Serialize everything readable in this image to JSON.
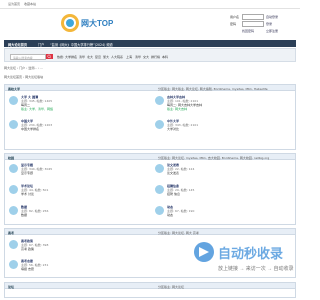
{
  "topbar": {
    "set_home": "设为首页",
    "bookmark": "收藏本站"
  },
  "header": {
    "logo_text": "网大TOP",
    "login": {
      "user_label": "用户名",
      "pass_label": "密码",
      "autologin": "自动登录",
      "find_pass": "找回密码",
      "login_btn": "登录",
      "register_btn": "立即注册"
    }
  },
  "nav": {
    "items": [
      "网大论坛首页",
      "门户",
      "“监测《网大》中国大学排行榜”(2024) 频道"
    ]
  },
  "subnav": {
    "search_placeholder": "请输入搜索内容",
    "hot_label": "热搜:",
    "hot": [
      "大学排名",
      "清华",
      "北大",
      "复旦",
      "浙大",
      "人大院系",
      "上海",
      "清华",
      "交大",
      "排行榜",
      "本科"
    ]
  },
  "breadcrumb": {
    "items": [
      "网大论坛",
      "›",
      "门户",
      "›",
      "监测...",
      "›",
      "..."
    ]
  },
  "breadcrumb2": {
    "text": "网大论坛首页 › 网大论坛版块"
  },
  "sections": [
    {
      "title": "高校大学",
      "moderator": "分区版主: 网大版主, 网大论坛, 网大编辑, BnnShema, mysites, MK1, HabsoMe",
      "rss": "RSS",
      "forums": [
        {
          "name": "大学 大 圆满",
          "stat": "主题: 345, 帖数: 1405",
          "last": "每周二",
          "extra": "版主: 大学、清华、网络"
        },
        {
          "name": "吉林大学吉林",
          "stat": "主题: 101, 帖数: 2101",
          "last": "每周二: 网大吉林大学吉林",
          "extra": "版主: 网大吉林"
        },
        {
          "name": "中国大学",
          "stat": "主题: 234, 帖数: 1203",
          "last": "中国大学排名",
          "extra": ""
        },
        {
          "name": "中外大学",
          "stat": "主题: 343, 帖数: 2101",
          "last": "大学对比",
          "extra": ""
        }
      ]
    },
    {
      "title": "校园",
      "moderator": "分区版主: 网大论坛, mysites, MK1, 吉大校园, BnnShema, 网大校园, netbig.org",
      "rss": "RSS",
      "forums": [
        {
          "name": "显示专题",
          "stat": "主题: 344, 帖数: 3045",
          "last": "显示专题",
          "extra": ""
        },
        {
          "name": "论文发表",
          "stat": "主题: 22, 帖数: 124",
          "last": "论文发表",
          "extra": ""
        },
        {
          "name": "学术论坛",
          "stat": "主题: 44, 帖数: 501",
          "last": "学术 讨论",
          "extra": ""
        },
        {
          "name": "招聘信息",
          "stat": "主题: 29, 帖数: 145",
          "last": "招聘 信息",
          "extra": ""
        },
        {
          "name": "数据",
          "stat": "主题: 82, 帖数: 256",
          "last": "数据",
          "extra": ""
        },
        {
          "name": "动态",
          "stat": "主题: 67, 帖数: 190",
          "last": "动态",
          "extra": ""
        }
      ]
    },
    {
      "title": "高考",
      "moderator": "分区版主: 网大论坛, 网大 高考",
      "rss": "RSS",
      "forums": [
        {
          "name": "高考政策",
          "stat": "主题: 67, 帖数: 398",
          "last": "高考 政策",
          "extra": ""
        },
        {
          "name": "高考志愿",
          "stat": "主题: 56, 帖数: 231",
          "last": "填报 志愿",
          "extra": ""
        }
      ]
    },
    {
      "title": "论坛",
      "moderator": "分区版主: 网大论坛",
      "rss": "RSS",
      "forums": []
    }
  ],
  "watermark": {
    "text": "自动秒收录",
    "sub": "放上链接 → 来访一次 → 自动收录"
  }
}
